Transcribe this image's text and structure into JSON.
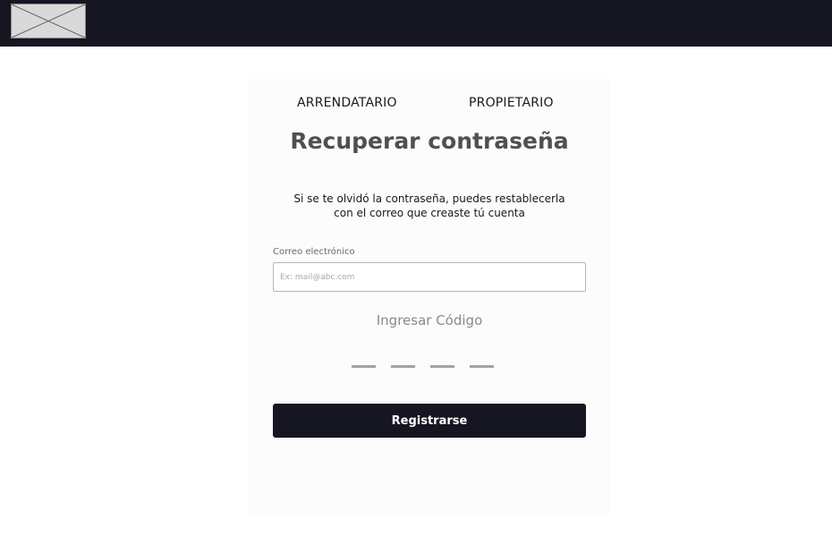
{
  "header": {
    "logo_icon": "image-placeholder-icon",
    "background": "#161522"
  },
  "tabs": {
    "tenant_label": "ARRENDATARIO",
    "owner_label": "PROPIETARIO"
  },
  "form": {
    "title": "Recuperar contraseña",
    "subtitle_line1": "Si se te olvidó la contraseña, puedes restablecerla",
    "subtitle_line2": "con el correo que creaste tú cuenta",
    "email_label": "Correo electrónico",
    "email_placeholder": "Ex: mail@abc.com",
    "email_value": "",
    "code_label": "Ingresar Código",
    "code_digits": [
      "",
      "",
      "",
      ""
    ],
    "submit_label": "Registrarse"
  },
  "colors": {
    "accent": "#161522",
    "card": "#fcfcfc"
  }
}
